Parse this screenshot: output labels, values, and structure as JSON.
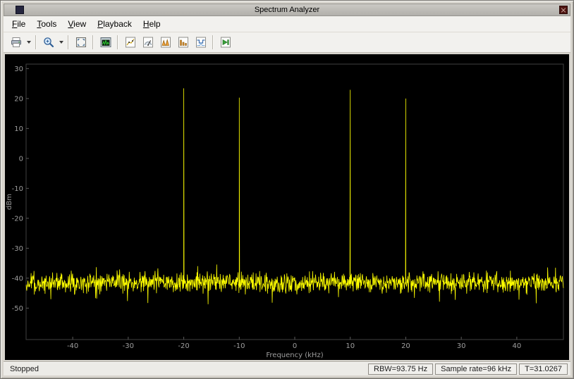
{
  "window": {
    "title": "Spectrum Analyzer"
  },
  "menu": {
    "items": [
      "File",
      "Tools",
      "View",
      "Playback",
      "Help"
    ]
  },
  "toolbar": {
    "icons": [
      "printer-export-icon",
      "dropdown-caret-icon",
      "zoom-in-icon",
      "dropdown-caret-icon",
      "fit-to-view-icon",
      "spectrum-settings-icon",
      "cursor-measurements-icon",
      "signal-statistics-icon",
      "peak-finder-icon",
      "distortion-measurements-icon",
      "spectral-mask-icon",
      "step-forward-icon"
    ]
  },
  "chart_data": {
    "type": "line",
    "title": "",
    "xlabel": "Frequency (kHz)",
    "ylabel": "dBm",
    "xlim": [
      -48.4,
      48.4
    ],
    "ylim": [
      -60.5,
      31.5
    ],
    "xticks": [
      -40,
      -30,
      -20,
      -10,
      0,
      10,
      20,
      30,
      40
    ],
    "yticks": [
      30,
      20,
      10,
      0,
      -10,
      -20,
      -30,
      -40,
      -50
    ],
    "grid": false,
    "legend_position": "none",
    "background": "#000000",
    "axes_border_color": "#3f3f3f",
    "tick_label_color": "#9e9e9e",
    "trace_color": "#ffff00",
    "noise_floor_dbm": -41.5,
    "noise_amplitude_db": 3.2,
    "peaks": [
      {
        "freq_khz": -20,
        "level_dbm": 23.4
      },
      {
        "freq_khz": -10,
        "level_dbm": 20.3
      },
      {
        "freq_khz": 10,
        "level_dbm": 22.9
      },
      {
        "freq_khz": 20,
        "level_dbm": 20.0
      }
    ]
  },
  "status_bar": {
    "status": "Stopped",
    "rbw": "RBW=93.75 Hz",
    "sample_rate": "Sample rate=96 kHz",
    "time": "T=31.0267"
  }
}
